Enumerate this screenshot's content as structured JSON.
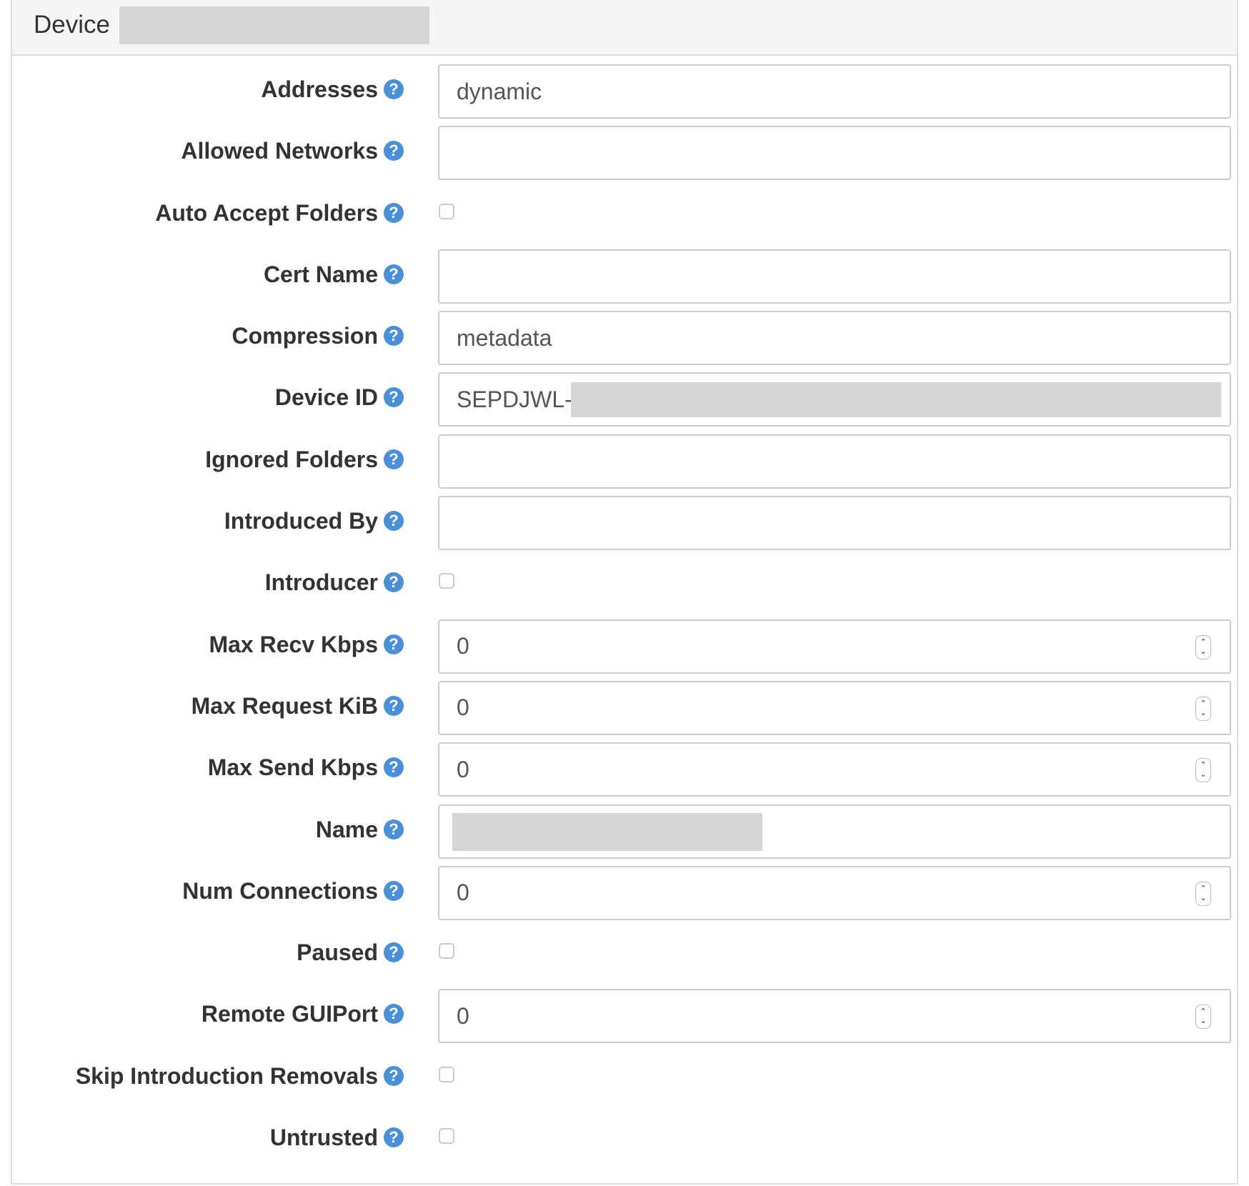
{
  "panel": {
    "title": "Device"
  },
  "fields": {
    "addresses": {
      "label": "Addresses",
      "value": "dynamic"
    },
    "allowed_networks": {
      "label": "Allowed Networks",
      "value": ""
    },
    "auto_accept_folders": {
      "label": "Auto Accept Folders",
      "checked": false
    },
    "cert_name": {
      "label": "Cert Name",
      "value": ""
    },
    "compression": {
      "label": "Compression",
      "value": "metadata"
    },
    "device_id": {
      "label": "Device ID",
      "value": "SEPDJWL-"
    },
    "ignored_folders": {
      "label": "Ignored Folders",
      "value": ""
    },
    "introduced_by": {
      "label": "Introduced By",
      "value": ""
    },
    "introducer": {
      "label": "Introducer",
      "checked": false
    },
    "max_recv_kbps": {
      "label": "Max Recv Kbps",
      "value": "0"
    },
    "max_request_kib": {
      "label": "Max Request KiB",
      "value": "0"
    },
    "max_send_kbps": {
      "label": "Max Send Kbps",
      "value": "0"
    },
    "name": {
      "label": "Name",
      "value": ""
    },
    "num_connections": {
      "label": "Num Connections",
      "value": "0"
    },
    "paused": {
      "label": "Paused",
      "checked": false
    },
    "remote_gui_port": {
      "label": "Remote GUIPort",
      "value": "0"
    },
    "skip_introduction_removals": {
      "label": "Skip Introduction Removals",
      "checked": false
    },
    "untrusted": {
      "label": "Untrusted",
      "checked": false
    }
  },
  "help_glyph": "?",
  "spinner": {
    "up": "⌃",
    "down": "⌄"
  }
}
